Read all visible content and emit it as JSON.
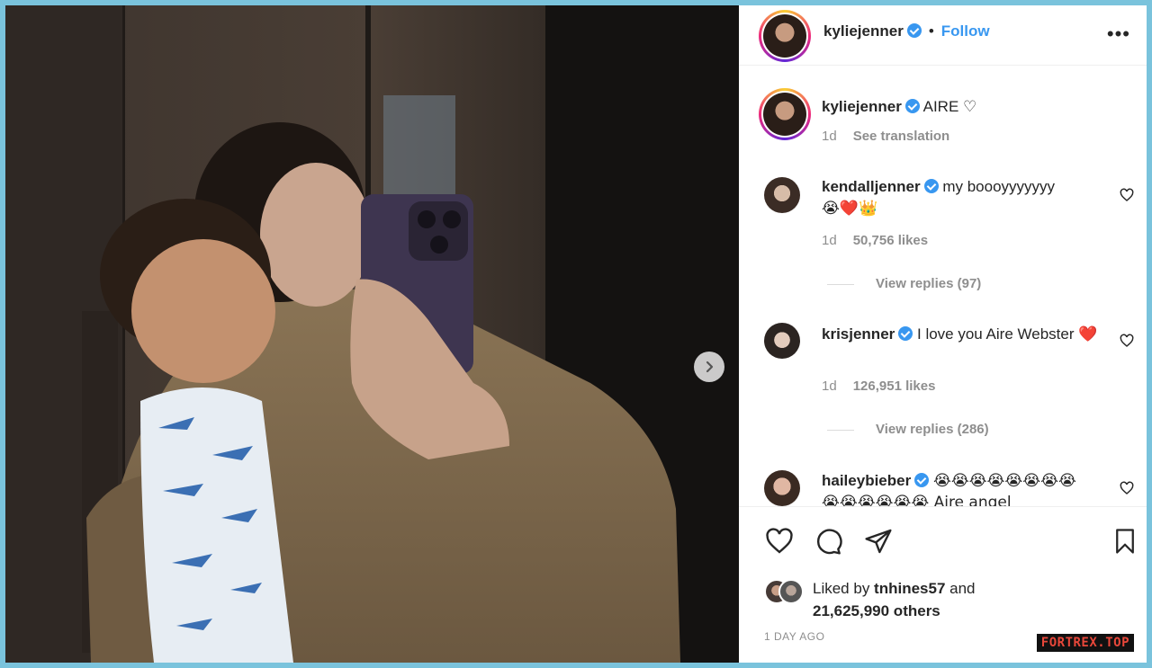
{
  "post_header": {
    "username": "kyliejenner",
    "follow_label": "Follow",
    "separator": "•",
    "more_label": "•••"
  },
  "caption": {
    "username": "kyliejenner",
    "text": "AIRE ♡",
    "time": "1d",
    "translate_label": "See translation"
  },
  "comments": [
    {
      "username": "kendalljenner",
      "text": "my boooyyyyyyy",
      "emoji": "😭❤️👑",
      "time": "1d",
      "likes": "50,756 likes",
      "view_replies": "View replies (97)"
    },
    {
      "username": "krisjenner",
      "text": "I love you Aire Webster",
      "emoji": "❤️",
      "time": "1d",
      "likes": "126,951 likes",
      "view_replies": "View replies (286)"
    },
    {
      "username": "haileybieber",
      "text_line1": "😭😭😭😭😭😭😭😭",
      "text_line2": "😭😭😭😭😭😭 Aire angel"
    }
  ],
  "likes_summary": {
    "prefix": "Liked by ",
    "user": "tnhines57",
    "middle": " and",
    "count": "21,625,990 others"
  },
  "post_date": "1 DAY AGO",
  "watermark": "FORTREX.TOP",
  "colors": {
    "accent": "#3897f0",
    "text": "#262626",
    "muted": "#8e8e8e",
    "border": "#7ac3dc"
  }
}
